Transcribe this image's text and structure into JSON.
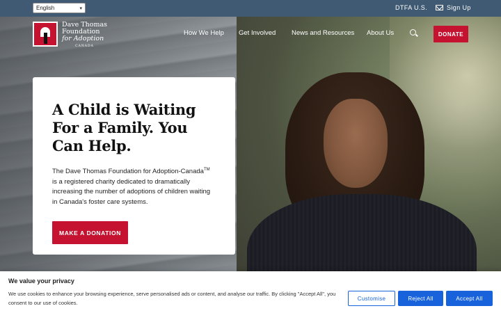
{
  "topbar": {
    "language": "English",
    "dtfa_link": "DTFA U.S.",
    "signin": "Sign Up"
  },
  "header": {
    "logo": {
      "line1": "Dave Thomas",
      "line2": "Foundation",
      "line3": "for Adoption",
      "sub": "CANADA"
    },
    "nav": [
      "How We Help",
      "Get Involved",
      "News and Resources",
      "About Us"
    ],
    "donate": "DONATE"
  },
  "hero": {
    "title": "A Child is Waiting For a Family. You Can Help.",
    "body_pre": "The Dave Thomas Foundation for Adoption-Canada",
    "body_sup": "TM",
    "body_post": " is a registered charity dedicated to dramatically increasing the number of adoptions of children waiting in Canada's foster care systems.",
    "cta": "MAKE A DONATION"
  },
  "cookie": {
    "title": "We value your privacy",
    "text": "We use cookies to enhance your browsing experience, serve personalised ads or content, and analyse our traffic. By clicking \"Accept All\", you consent to our use of cookies.",
    "customise": "Customise",
    "reject": "Reject All",
    "accept": "Accept All"
  },
  "colors": {
    "brand_red": "#c41230",
    "topbar": "#3f5a72",
    "cookie_blue": "#1863dc"
  }
}
